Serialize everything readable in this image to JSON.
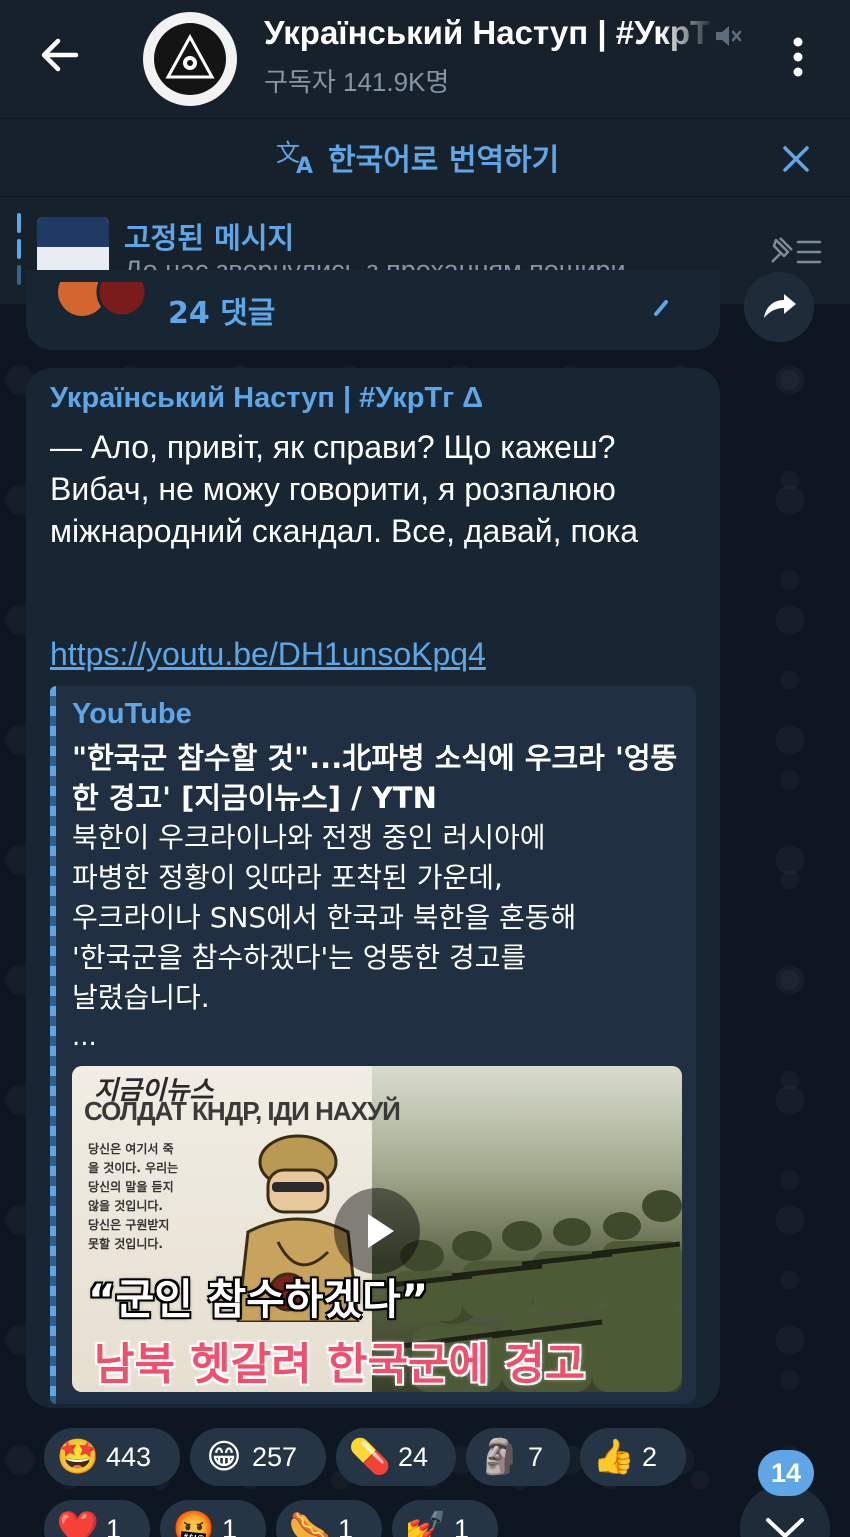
{
  "header": {
    "title": "Український Наступ | #УкрТг Δ",
    "subscribers": "구독자 141.9K명",
    "back_icon": "arrow-left-icon",
    "mute_icon": "muted-speaker-icon",
    "menu_icon": "more-vertical-icon"
  },
  "translate_bar": {
    "label": "한국어로 번역하기",
    "icon": "translate-icon",
    "close_icon": "close-icon"
  },
  "pinned": {
    "title": "고정된 메시지",
    "text": "До нас звернулись з проханням пошири…",
    "list_icon": "pinned-list-icon"
  },
  "previous_message": {
    "comments_label": "24 댓글"
  },
  "message": {
    "author": "Український Наступ | #УкрТг Δ",
    "text": "— Ало, привіт, як справи? Що кажеш? Вибач, не можу говорити, я розпалюю міжнародний скандал. Все, давай, пока",
    "link": "https://youtu.be/DH1unsoKpq4",
    "preview": {
      "site": "YouTube",
      "title": "\"한국군 참수할 것\"...北파병 소식에 우크라 '엉뚱한 경고' [지금이뉴스] / YTN",
      "description": "북한이 우크라이나와 전쟁 중인 러시아에\n파병한 정황이 잇따라 포착된 가운데,\n우크라이나 SNS에서 한국과 북한을 혼동해\n'한국군을 참수하겠다'는 엉뚱한 경고를\n날렸습니다.",
      "ellipsis": "...",
      "thumbnail": {
        "brand": "지금이뉴스",
        "cyrillic": "СОЛДАТ КНДР, ІДИ НАХУЙ",
        "comic_text": "당신은 여기서 죽\n을 것이다. 우리는\n당신의 말을 듣지\n않을 것입니다.\n당신은 구원받지\n못할 것입니다.",
        "quote": "“군인 참수하겠다”",
        "headline": "남북 헷갈려 한국군에 경고"
      }
    }
  },
  "reactions": [
    {
      "emoji": "🤩",
      "count": "443"
    },
    {
      "emoji": "😁",
      "count": "257"
    },
    {
      "emoji": "💊",
      "count": "24"
    },
    {
      "emoji": "🗿",
      "count": "7"
    },
    {
      "emoji": "👍",
      "count": "2"
    },
    {
      "emoji": "❤️",
      "count": "1"
    },
    {
      "emoji": "🤬",
      "count": "1"
    },
    {
      "emoji": "🌭",
      "count": "1"
    },
    {
      "emoji": "💅",
      "count": "1"
    }
  ],
  "unread_count": "14",
  "colors": {
    "accent": "#5fa6e6",
    "header_bg": "#17212b",
    "bubble_bg": "#182533",
    "chat_bg": "#0e1621"
  }
}
